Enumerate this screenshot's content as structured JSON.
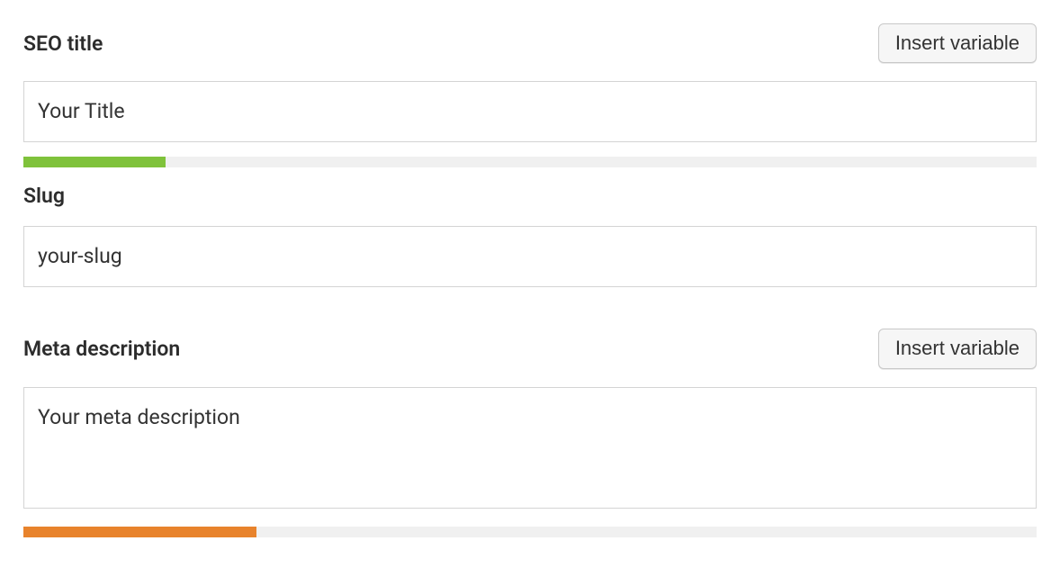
{
  "seo_title": {
    "label": "SEO title",
    "button_label": "Insert variable",
    "value": "Your Title",
    "progress_percent": 14,
    "progress_color": "green"
  },
  "slug": {
    "label": "Slug",
    "value": "your-slug"
  },
  "meta_description": {
    "label": "Meta description",
    "button_label": "Insert variable",
    "value": "Your meta description",
    "progress_percent": 23,
    "progress_color": "orange"
  }
}
